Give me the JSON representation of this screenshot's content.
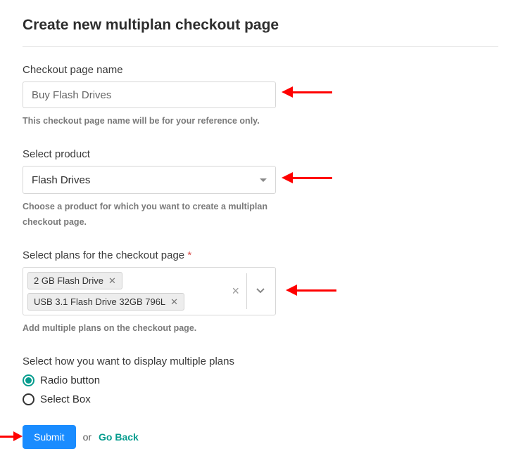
{
  "title": "Create new multiplan checkout page",
  "fields": {
    "name": {
      "label": "Checkout page name",
      "value": "Buy Flash Drives",
      "help": "This checkout page name will be for your reference only."
    },
    "product": {
      "label": "Select product",
      "value": "Flash Drives",
      "help": "Choose a product for which you want to create a multiplan checkout page."
    },
    "plans": {
      "label": "Select plans for the checkout page",
      "required_mark": "*",
      "selected": [
        "2 GB Flash Drive",
        "USB 3.1 Flash Drive 32GB 796L"
      ],
      "help": "Add multiple plans on the checkout page."
    },
    "display": {
      "label": "Select how you want to display multiple plans",
      "options": [
        "Radio button",
        "Select Box"
      ],
      "selected": "Radio button"
    }
  },
  "actions": {
    "submit": "Submit",
    "or": "or",
    "goback": "Go Back"
  }
}
